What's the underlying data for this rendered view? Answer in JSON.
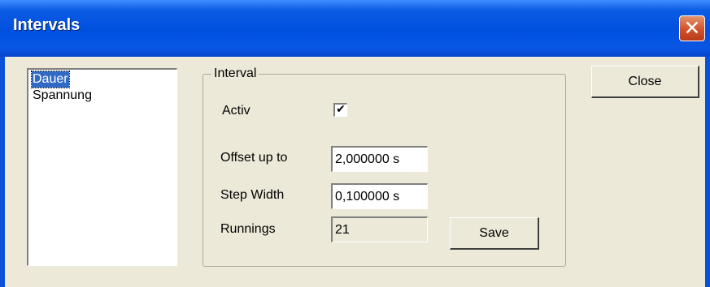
{
  "window": {
    "title": "Intervals",
    "close_glyph": "✕"
  },
  "list": {
    "items": [
      {
        "label": "Dauer",
        "selected": true
      },
      {
        "label": "Spannung",
        "selected": false
      }
    ]
  },
  "interval_group": {
    "legend": "Interval",
    "activ_label": "Activ",
    "activ_checked": true,
    "activ_checkmark": "✔",
    "offset_label": "Offset up to",
    "offset_value": "2,000000 s",
    "step_label": "Step Width",
    "step_value": "0,100000 s",
    "runnings_label": "Runnings",
    "runnings_value": "21",
    "save_label": "Save"
  },
  "buttons": {
    "close_label": "Close"
  },
  "colors": {
    "titlebar": "#0050e0",
    "selection": "#316ac5",
    "dialog_bg": "#ece9d8",
    "close_button": "#d2522b"
  }
}
